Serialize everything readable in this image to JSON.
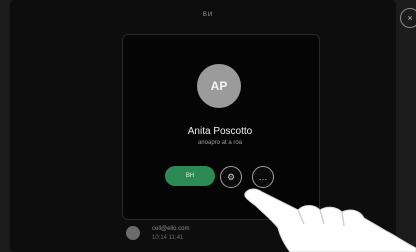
{
  "header": {
    "title": "ВИ"
  },
  "window": {
    "close_icon": "close-icon"
  },
  "contact": {
    "initials": "AP",
    "name": "Anita Poscotto",
    "subtitle": "anoapro at a roa"
  },
  "actions": {
    "call_label": "ВН",
    "call_icon": "phone-icon",
    "settings_icon": "gear-icon",
    "more_icon": "more-icon"
  },
  "footer": {
    "email": "cell@ello.com",
    "time": "10:14 11:41"
  },
  "colors": {
    "background": "#0d0d0d",
    "card": "#050505",
    "call_green": "#2c8a55",
    "avatar_gray": "#9b9b9b"
  }
}
